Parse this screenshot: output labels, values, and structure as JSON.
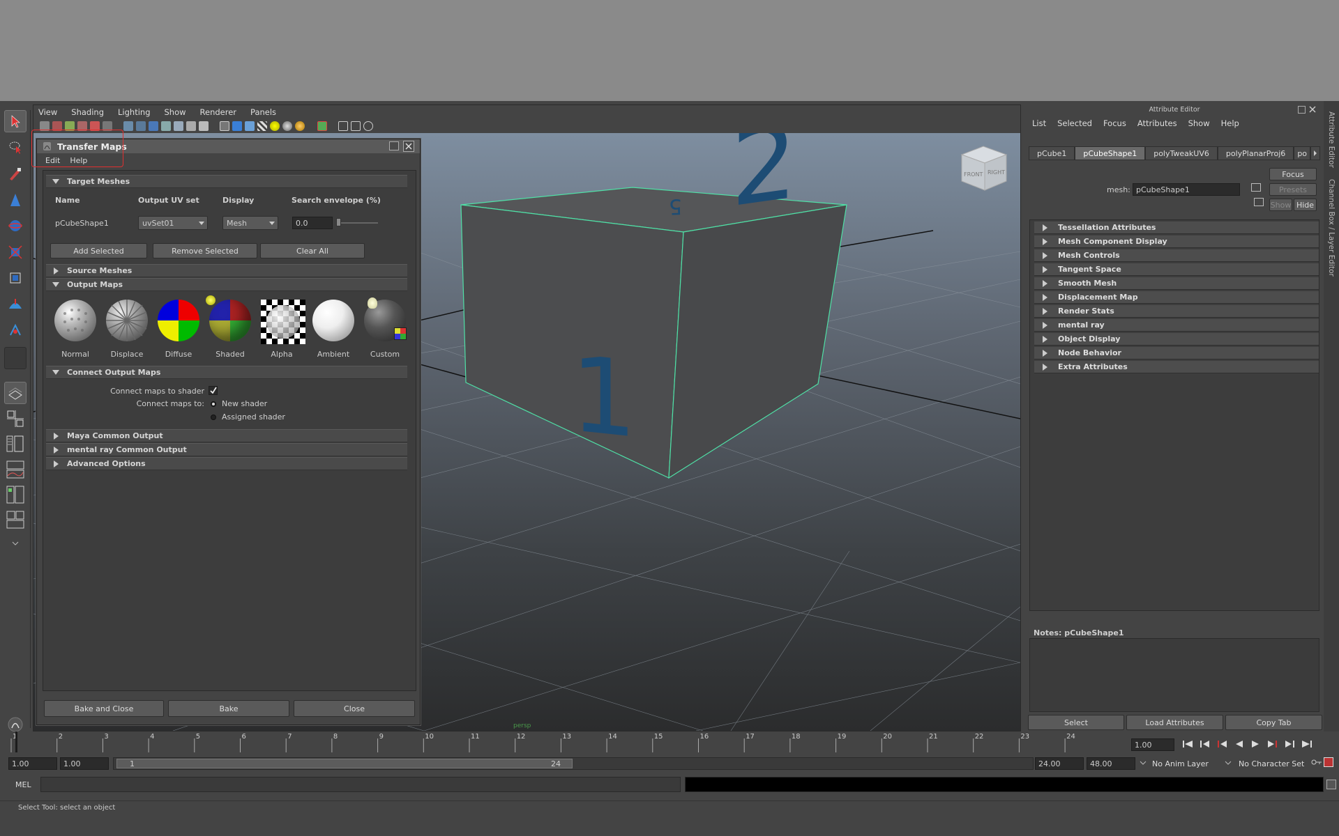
{
  "viewport": {
    "menu": [
      "View",
      "Shading",
      "Lighting",
      "Show",
      "Renderer",
      "Panels"
    ],
    "viewcube": {
      "front": "FRONT",
      "right": "RIGHT"
    },
    "cube_faces": [
      "1",
      "2",
      "5"
    ],
    "camera_label": "persp"
  },
  "transfer_maps": {
    "title": "Transfer Maps",
    "menu": [
      "Edit",
      "Help"
    ],
    "target_meshes": {
      "header": "Target Meshes",
      "columns": [
        "Name",
        "Output UV set",
        "Display",
        "Search envelope (%)"
      ],
      "row": {
        "name": "pCubeShape1",
        "uv_set": "uvSet01",
        "display": "Mesh",
        "envelope": "0.0"
      },
      "buttons": [
        "Add Selected",
        "Remove Selected",
        "Clear All"
      ]
    },
    "source_meshes": "Source Meshes",
    "output_maps": {
      "header": "Output Maps",
      "maps": [
        "Normal",
        "Displace",
        "Diffuse",
        "Shaded",
        "Alpha",
        "Ambient",
        "Custom"
      ]
    },
    "connect_output_maps": {
      "header": "Connect Output Maps",
      "connect_label": "Connect maps to shader",
      "connect_checked": true,
      "connect_to_label": "Connect maps to:",
      "options": [
        "New shader",
        "Assigned shader"
      ]
    },
    "collapsed_sections": [
      "Maya Common Output",
      "mental ray Common Output",
      "Advanced Options"
    ],
    "footer_buttons": [
      "Bake and Close",
      "Bake",
      "Close"
    ]
  },
  "attribute_editor": {
    "title": "Attribute Editor",
    "menu": [
      "List",
      "Selected",
      "Focus",
      "Attributes",
      "Show",
      "Help"
    ],
    "tabs": [
      "pCube1",
      "pCubeShape1",
      "polyTweakUV6",
      "polyPlanarProj6",
      "po"
    ],
    "active_tab": "pCubeShape1",
    "mesh_label": "mesh:",
    "mesh_value": "pCubeShape1",
    "side_buttons": [
      "Focus",
      "Presets",
      "Show",
      "Hide"
    ],
    "sections": [
      "Tessellation Attributes",
      "Mesh Component Display",
      "Mesh Controls",
      "Tangent Space",
      "Smooth Mesh",
      "Displacement Map",
      "Render Stats",
      "mental ray",
      "Object Display",
      "Node Behavior",
      "Extra Attributes"
    ],
    "notes_label": "Notes:  pCubeShape1",
    "bottom_buttons": [
      "Select",
      "Load Attributes",
      "Copy Tab"
    ],
    "side_tabs": [
      "Attribute Editor",
      "Channel Box / Layer Editor"
    ]
  },
  "timeline": {
    "ticks": [
      "1",
      "2",
      "3",
      "4",
      "5",
      "6",
      "7",
      "8",
      "9",
      "10",
      "11",
      "12",
      "13",
      "14",
      "15",
      "16",
      "17",
      "18",
      "19",
      "20",
      "21",
      "22",
      "23",
      "24"
    ],
    "current_frame": "1.00"
  },
  "range": {
    "start": "1.00",
    "playback_start": "1.00",
    "slider_start": "1",
    "slider_end": "24",
    "playback_end": "24.00",
    "end": "48.00",
    "anim_layer": "No Anim Layer",
    "character_set": "No Character Set"
  },
  "command_line": {
    "label": "MEL"
  },
  "help_line": "Select Tool: select an object"
}
